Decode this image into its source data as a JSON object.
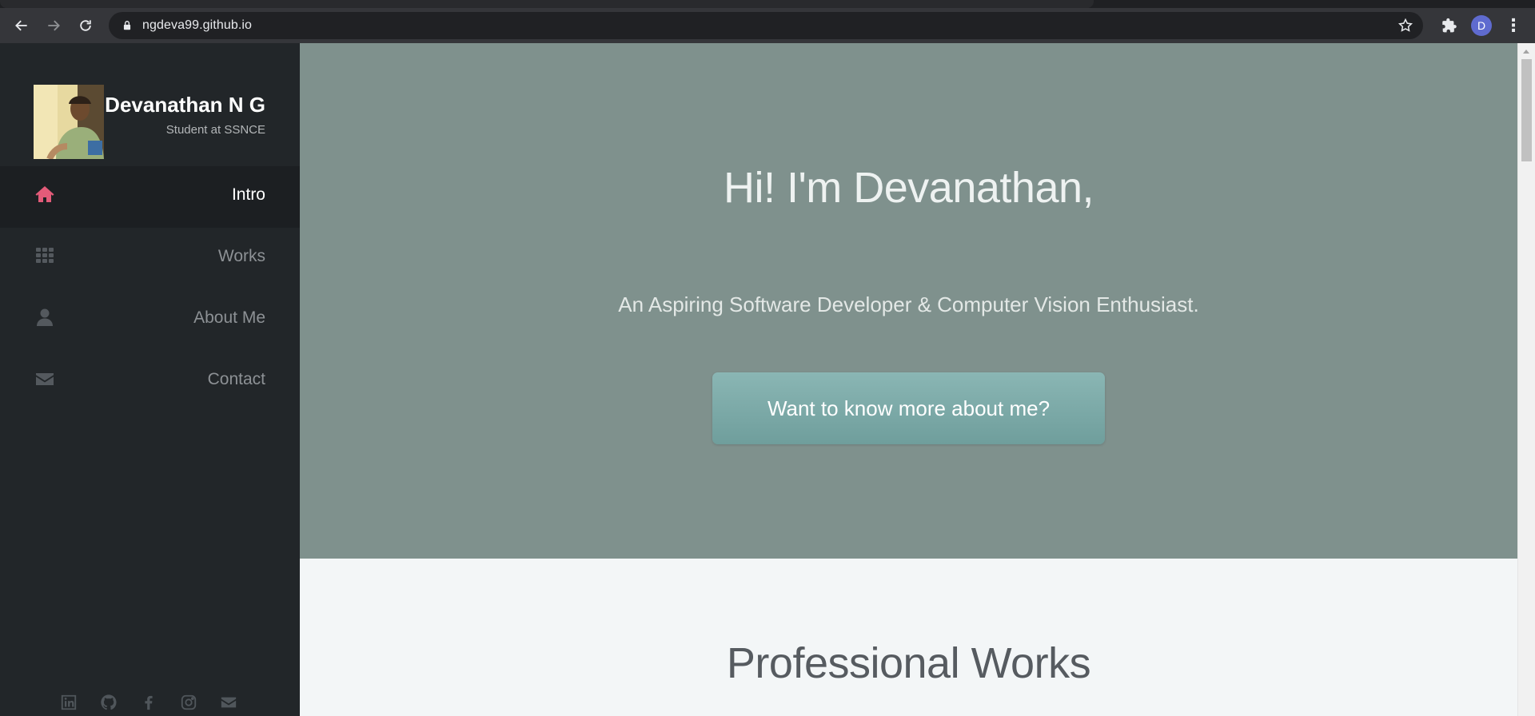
{
  "browser": {
    "url": "ngdeva99.github.io",
    "profile_initial": "D"
  },
  "sidebar": {
    "name": "Devanathan N G",
    "role": "Student at SSNCE",
    "nav": [
      {
        "label": "Intro",
        "icon": "home-icon",
        "active": true
      },
      {
        "label": "Works",
        "icon": "grid-icon",
        "active": false
      },
      {
        "label": "About Me",
        "icon": "user-icon",
        "active": false
      },
      {
        "label": "Contact",
        "icon": "envelope-icon",
        "active": false
      }
    ],
    "social": [
      "linkedin-icon",
      "github-icon",
      "facebook-icon",
      "instagram-icon",
      "email-icon"
    ]
  },
  "hero": {
    "title": "Hi! I'm Devanathan,",
    "subtitle": "An Aspiring Software Developer & Computer Vision Enthusiast.",
    "button_label": "Want to know more about me?"
  },
  "works": {
    "title": "Professional Works"
  },
  "colors": {
    "accent": "#e35b79",
    "sidebar_bg": "#222629",
    "hero_bg": "#7f918d",
    "button_bg": "#7eaaa8"
  }
}
